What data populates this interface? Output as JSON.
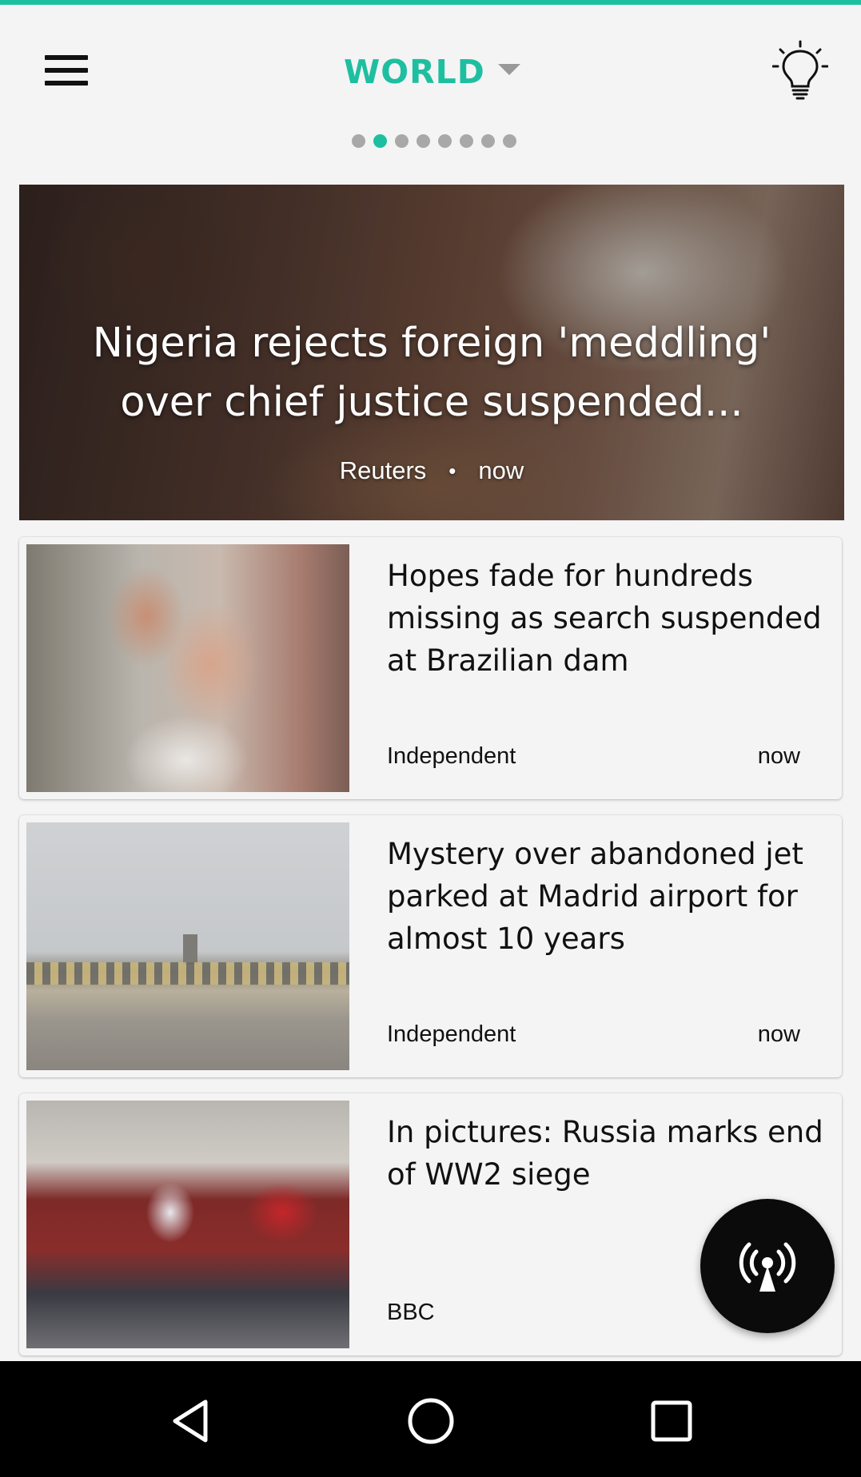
{
  "header": {
    "section_title": "WORLD",
    "menu_icon": "hamburger-menu-icon",
    "caret_icon": "caret-down-icon",
    "theme_icon": "lightbulb-icon",
    "accent_color": "#1ebfa0"
  },
  "pager": {
    "total_pages": 8,
    "active_index": 1
  },
  "hero": {
    "title": "Nigeria rejects foreign 'meddling' over chief justice suspended...",
    "source": "Reuters",
    "separator": "•",
    "time": "now"
  },
  "articles": [
    {
      "title": "Hopes fade for hundreds missing as search suspended at Brazilian dam",
      "source": "Independent",
      "time": "now"
    },
    {
      "title": "Mystery over abandoned jet parked at Madrid airport for almost 10 years",
      "source": "Independent",
      "time": "now"
    },
    {
      "title": "In pictures: Russia marks end of WW2 siege",
      "source": "BBC",
      "time": ""
    }
  ],
  "fab": {
    "icon": "broadcast-antenna-icon"
  },
  "system_nav": {
    "back_icon": "back-triangle-icon",
    "home_icon": "home-circle-icon",
    "recents_icon": "recents-square-icon"
  }
}
